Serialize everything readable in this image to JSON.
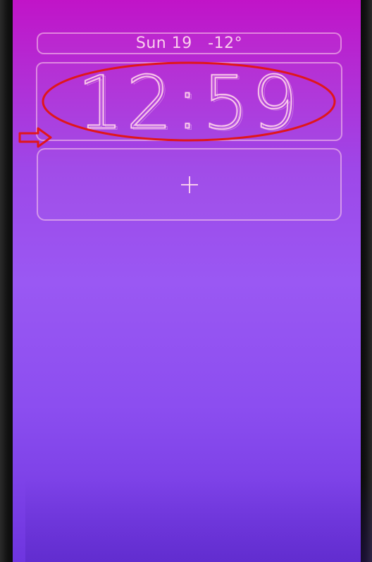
{
  "lock_screen": {
    "date_weather": "Sun 19   -12°",
    "time": "12:59",
    "add_widget_icon": "plus-icon"
  },
  "annotations": {
    "highlight_color": "#e0161b",
    "arrow_icon": "right-arrow-icon"
  },
  "colors": {
    "background_top": "#c114c8",
    "background_bottom": "#6e35df",
    "widget_outline": "#ffd2eb"
  }
}
